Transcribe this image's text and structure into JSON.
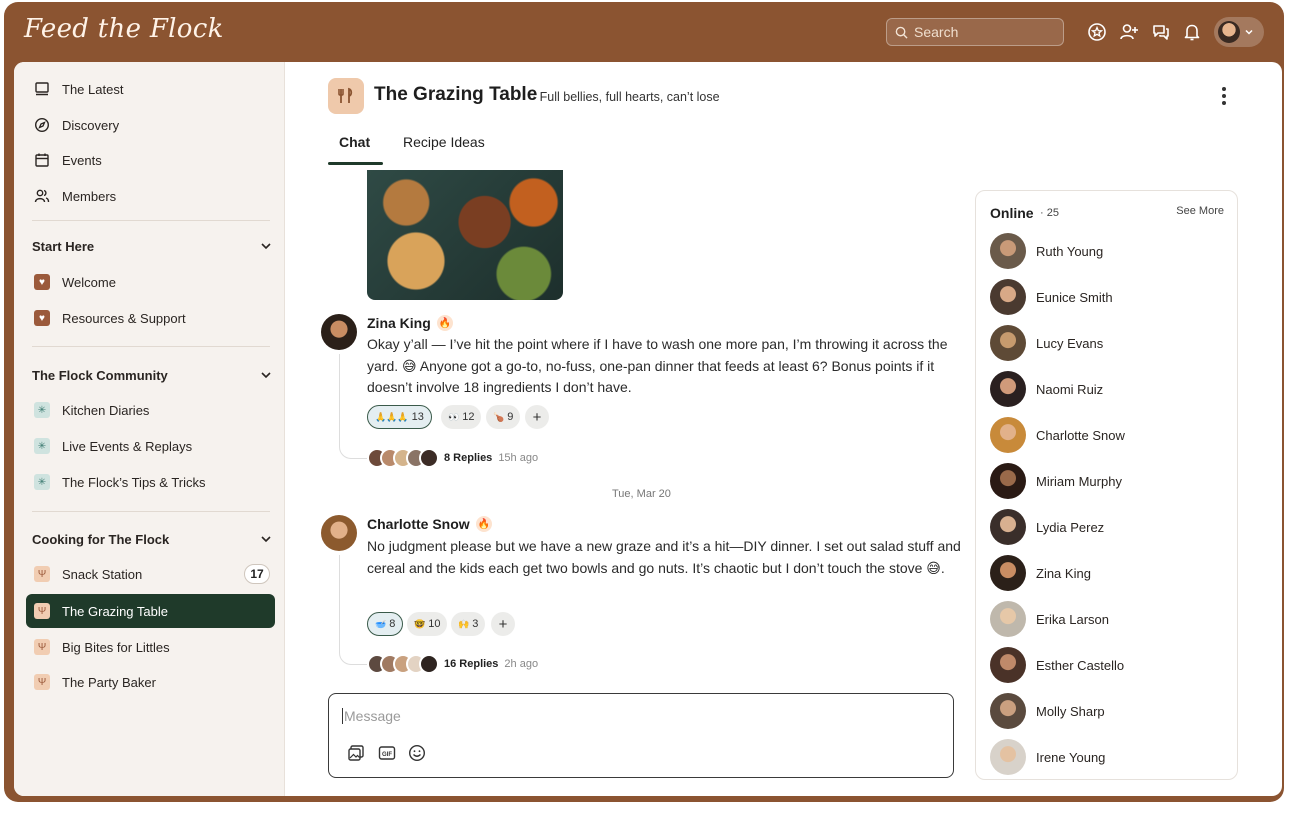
{
  "app": {
    "brand": "Feed the Flock"
  },
  "topbar": {
    "search_placeholder": "Search"
  },
  "sidebar": {
    "nav": [
      {
        "label": "The Latest",
        "icon": "monitor-icon"
      },
      {
        "label": "Discovery",
        "icon": "compass-icon"
      },
      {
        "label": "Events",
        "icon": "calendar-icon"
      },
      {
        "label": "Members",
        "icon": "members-icon"
      }
    ],
    "sections": [
      {
        "title": "Start Here",
        "items": [
          {
            "label": "Welcome"
          },
          {
            "label": "Resources & Support"
          }
        ]
      },
      {
        "title": "The Flock Community",
        "items": [
          {
            "label": "Kitchen Diaries"
          },
          {
            "label": "Live Events & Replays"
          },
          {
            "label": "The Flock’s Tips & Tricks"
          }
        ]
      },
      {
        "title": "Cooking for The Flock",
        "items": [
          {
            "label": "Snack Station",
            "badge": "17"
          },
          {
            "label": "The Grazing Table",
            "active": true
          },
          {
            "label": "Big Bites for Littles"
          },
          {
            "label": "The Party Baker"
          }
        ]
      }
    ]
  },
  "channel": {
    "title": "The Grazing Table",
    "subtitle": "· Full bellies, full hearts, can’t lose",
    "tabs": [
      {
        "label": "Chat",
        "active": true
      },
      {
        "label": "Recipe Ideas"
      }
    ]
  },
  "messages": [
    {
      "author": "Zina King",
      "text": "Okay y’all — I’ve hit the point where if I have to wash one more pan, I’m throwing it across the yard. 😅 Anyone got a go-to, no-fuss, one-pan dinner that feeds at least 6? Bonus points if it doesn’t involve 18 ingredients I don’t have.",
      "reactions": [
        {
          "emoji": "🙏🙏🙏",
          "count": "13"
        },
        {
          "emoji": "👀",
          "count": "12"
        },
        {
          "emoji": "🍗",
          "count": "9"
        }
      ],
      "replies": "8 Replies",
      "time": "15h ago"
    },
    {
      "author": "Charlotte Snow",
      "text": "No judgment please but we have a new graze and it’s a hit—DIY dinner. I set out salad stuff and cereal and the kids each get two bowls and go nuts. It’s chaotic but I don’t touch the stove 😅.",
      "reactions": [
        {
          "emoji": "🥣",
          "count": "8"
        },
        {
          "emoji": "🤓",
          "count": "10"
        },
        {
          "emoji": "🙌",
          "count": "3"
        }
      ],
      "replies": "16 Replies",
      "time": "2h ago"
    }
  ],
  "date_separator": "Tue, Mar 20",
  "composer": {
    "placeholder": "Message"
  },
  "online": {
    "title": "Online",
    "count": "· 25",
    "see_more": "See More",
    "members": [
      "Ruth Young",
      "Eunice Smith",
      "Lucy Evans",
      "Naomi Ruiz",
      "Charlotte Snow",
      "Miriam Murphy",
      "Lydia Perez",
      "Zina King",
      "Erika Larson",
      "Esther Castello",
      "Molly Sharp",
      "Irene Young"
    ]
  },
  "colors": {
    "frame": "#8b5431",
    "active_nav": "#1f3a2a",
    "accent_tan": "#efc9ab"
  }
}
